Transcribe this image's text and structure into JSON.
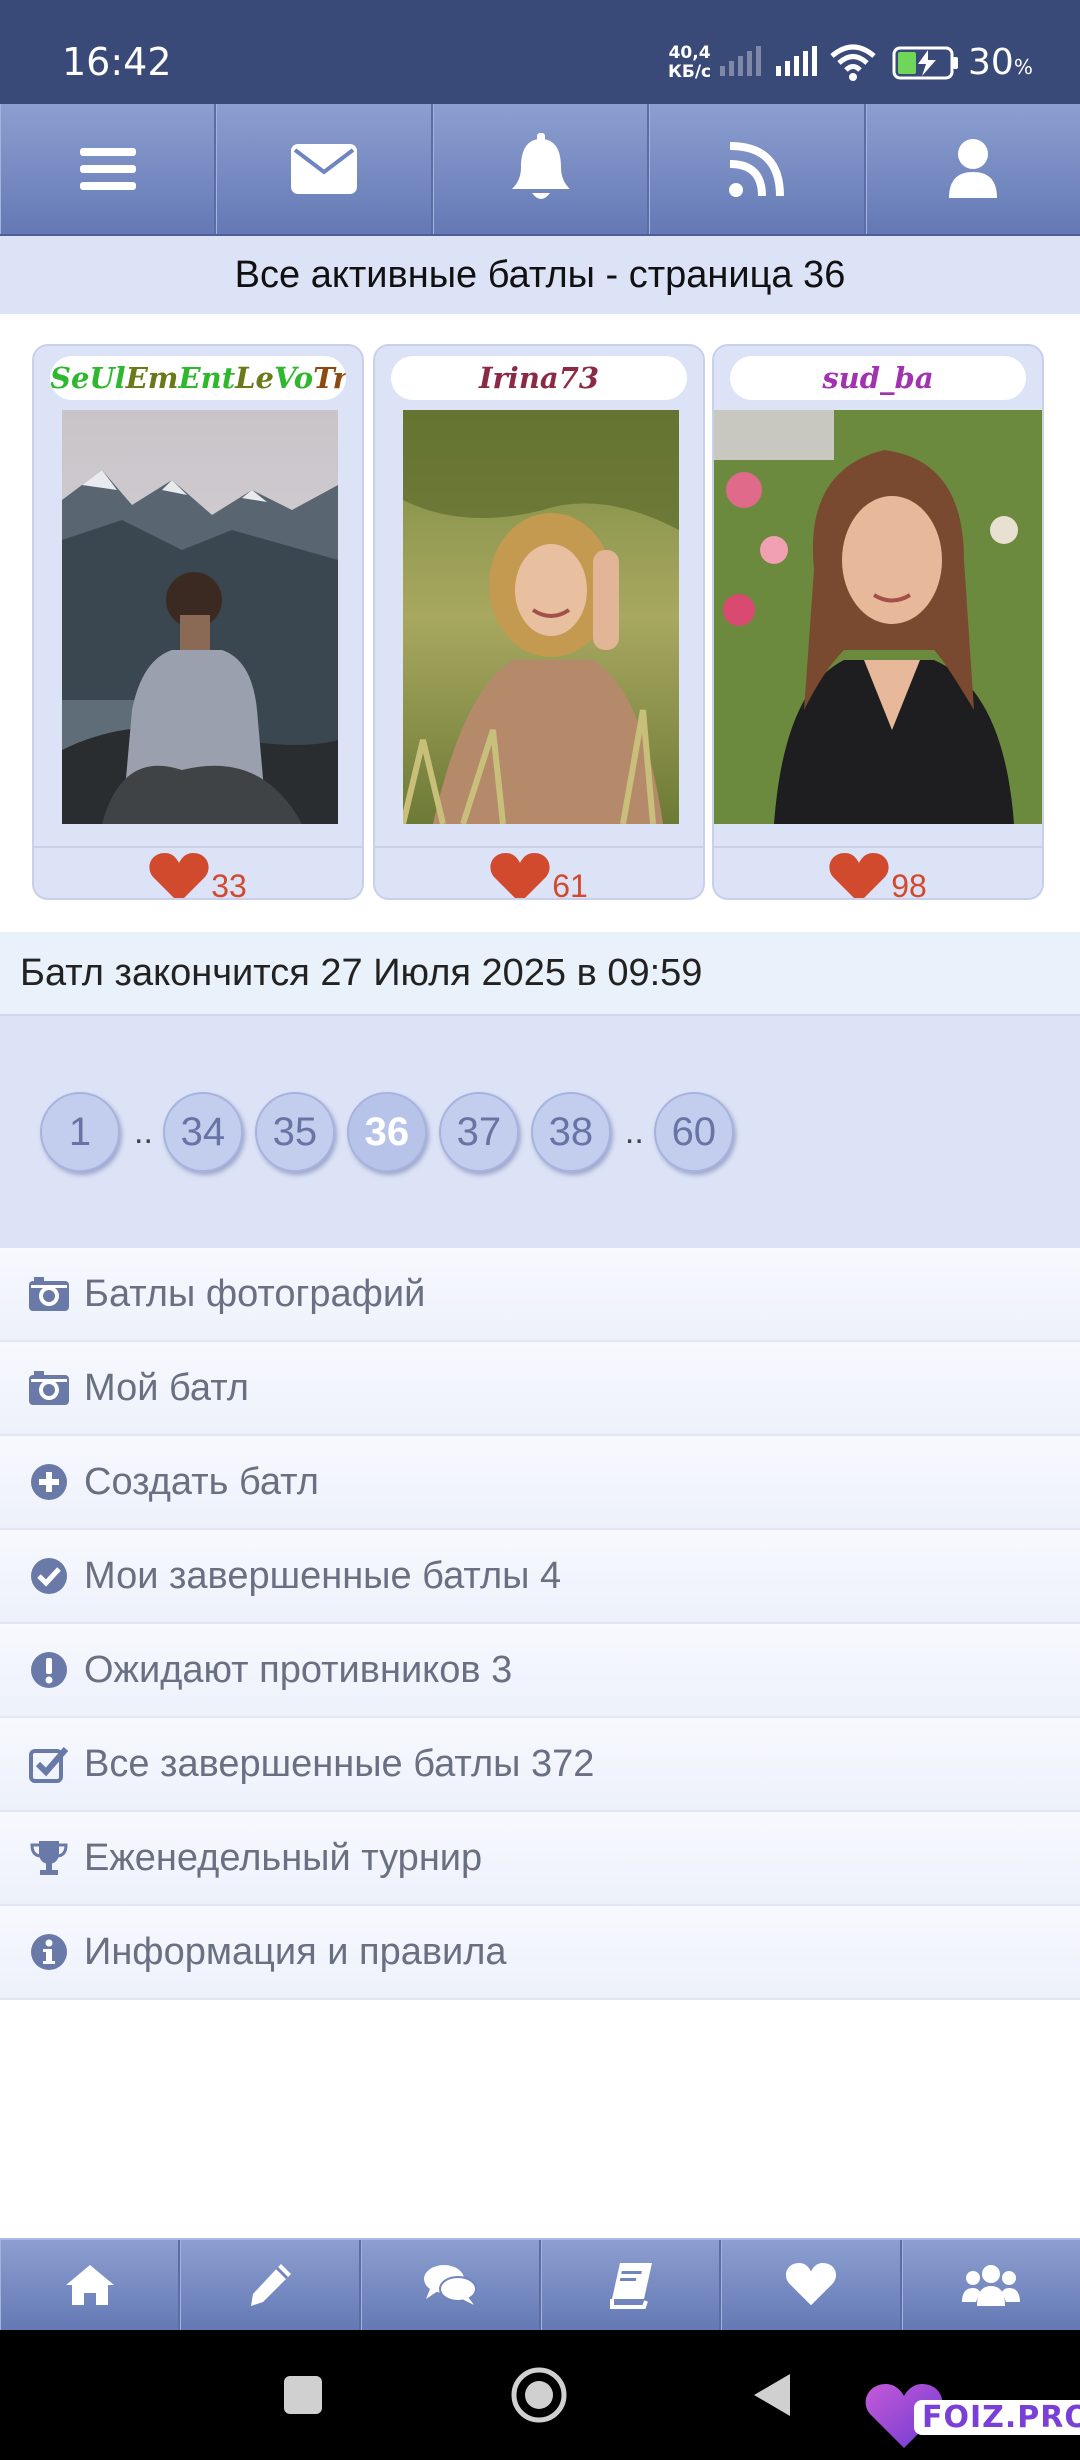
{
  "status_bar": {
    "time": "16:42",
    "net_speed_value": "40,4",
    "net_speed_unit": "КБ/с",
    "battery_percent": "30",
    "battery_unit": "%"
  },
  "top_nav": {
    "items": [
      {
        "icon": "menu-icon"
      },
      {
        "icon": "mail-icon"
      },
      {
        "icon": "bell-icon"
      },
      {
        "icon": "rss-icon"
      },
      {
        "icon": "user-icon"
      }
    ]
  },
  "page_title": "Все активные батлы - страница 36",
  "battle": {
    "participants": [
      {
        "name": "SeUlEmEntLeVoTrE",
        "votes": "33",
        "photo": "man-on-mountain-photo"
      },
      {
        "name": "Irina73",
        "votes": "61",
        "photo": "woman-in-grass-photo"
      },
      {
        "name": "sud_ba",
        "votes": "98",
        "photo": "woman-portrait-photo"
      }
    ],
    "ends_text": "Батл закончится 27 Июля 2025 в 09:59"
  },
  "pagination": {
    "first": "1",
    "pages": [
      "34",
      "35",
      "36",
      "37",
      "38"
    ],
    "current": "36",
    "last": "60",
    "ellipsis": ".."
  },
  "menu": {
    "items": [
      {
        "label": "Батлы фотографий",
        "icon": "camera-icon"
      },
      {
        "label": "Мой батл",
        "icon": "camera-icon"
      },
      {
        "label": "Создать батл",
        "icon": "plus-circle-icon"
      },
      {
        "label": "Мои завершенные батлы 4",
        "icon": "check-circle-icon"
      },
      {
        "label": "Ожидают противников 3",
        "icon": "exclamation-circle-icon"
      },
      {
        "label": "Все завершенные батлы 372",
        "icon": "checkbox-icon"
      },
      {
        "label": "Еженедельный турнир",
        "icon": "trophy-icon"
      },
      {
        "label": "Информация и правила",
        "icon": "info-circle-icon"
      }
    ]
  },
  "bottom_nav": {
    "items": [
      {
        "icon": "home-icon"
      },
      {
        "icon": "pencil-icon"
      },
      {
        "icon": "chat-icon"
      },
      {
        "icon": "book-icon"
      },
      {
        "icon": "heart-icon"
      },
      {
        "icon": "users-icon"
      }
    ]
  },
  "watermark": "FOIZ.PRO",
  "colors": {
    "nav_blue": "#6479b5",
    "accent_light": "#dde3f6",
    "heart_red": "#d14a2e",
    "name_green": "#2db82d",
    "name_maroon": "#8a2a45",
    "name_purple": "#a233b0"
  }
}
